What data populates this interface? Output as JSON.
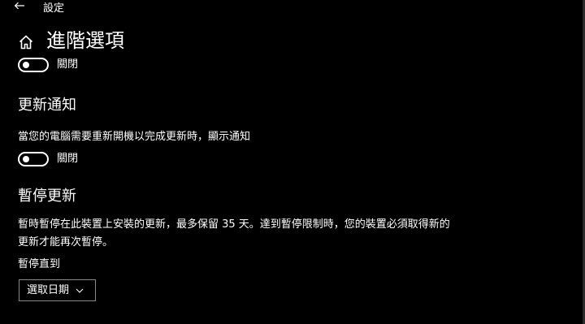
{
  "header": {
    "settings_title": "設定"
  },
  "page": {
    "title": "進階選項"
  },
  "top_toggle": {
    "state_label": "關閉"
  },
  "update_notifications": {
    "heading": "更新通知",
    "description": "當您的電腦需要重新開機以完成更新時，顯示通知",
    "state_label": "關閉"
  },
  "pause_updates": {
    "heading": "暫停更新",
    "description_line1": "暫時暫停在此裝置上安裝的更新，最多保留 35 天。達到暫停限制時，您的裝置必須取得新的",
    "description_line2": "更新才能再次暫停。",
    "pause_until_label": "暫停直到",
    "date_select_value": "選取日期"
  },
  "icons": {
    "back": "back-arrow-icon",
    "home": "home-icon",
    "chevron": "chevron-down-icon"
  },
  "colors": {
    "background": "#000000",
    "text": "#ffffff",
    "border": "#8a8a8a"
  }
}
